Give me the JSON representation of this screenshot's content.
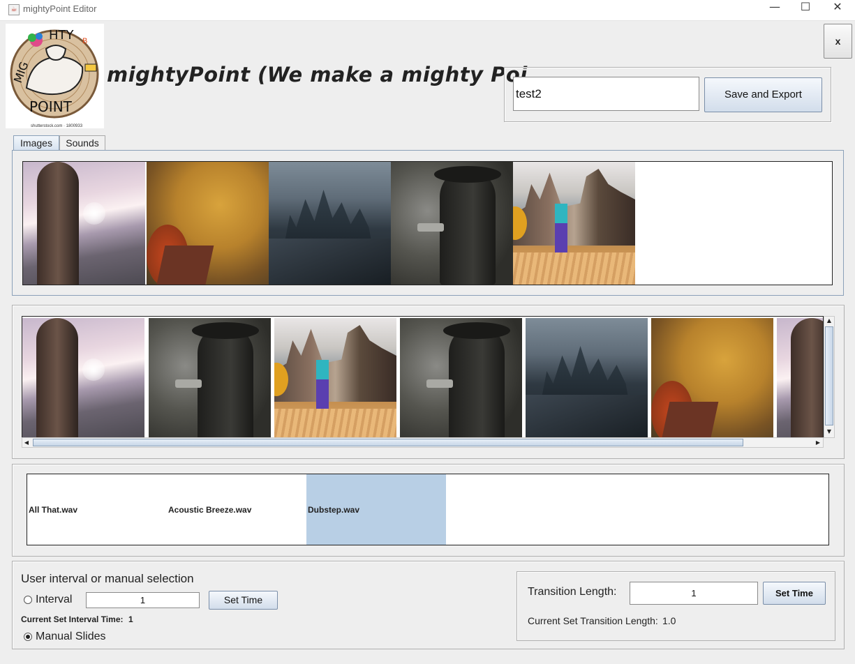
{
  "window": {
    "title": "mightyPoint Editor",
    "minimize": "—",
    "maximize": "☐",
    "close": "✕"
  },
  "header": {
    "logo_alt": "MIGHTY POINT",
    "app_title": "mightyPoint (We make a mighty Poi...",
    "close_label": "x",
    "project_name": "test2",
    "save_label": "Save and Export"
  },
  "tabs": [
    {
      "label": "Images",
      "selected": true
    },
    {
      "label": "Sounds",
      "selected": false
    }
  ],
  "image_library": [
    "sunset-statue",
    "autumn-cliff",
    "dark-castle",
    "gunman",
    "city-rooftop"
  ],
  "slides": [
    "sunset-statue",
    "gunman",
    "city-rooftop",
    "gunman",
    "dark-castle",
    "autumn-cliff",
    "sunset-statue"
  ],
  "sounds": [
    {
      "name": "All That.wav",
      "selected": false
    },
    {
      "name": "Acoustic Breeze.wav",
      "selected": false
    },
    {
      "name": "Dubstep.wav",
      "selected": true
    }
  ],
  "controls": {
    "heading": "User interval or manual selection",
    "interval_label": "Interval",
    "interval_value": "1",
    "set_time_label": "Set Time",
    "current_interval_label": "Current Set Interval Time:",
    "current_interval_value": "1",
    "manual_label": "Manual Slides",
    "mode": "manual",
    "transition_label": "Transition Length:",
    "transition_value": "1",
    "transition_set_label": "Set Time",
    "current_transition_label": "Current Set Transition Length:",
    "current_transition_value": "1.0"
  },
  "colors": {
    "accent": "#b8cfe5",
    "button_top": "#f5f8fc",
    "button_bottom": "#d2ddeb",
    "background": "#eeeeee"
  }
}
